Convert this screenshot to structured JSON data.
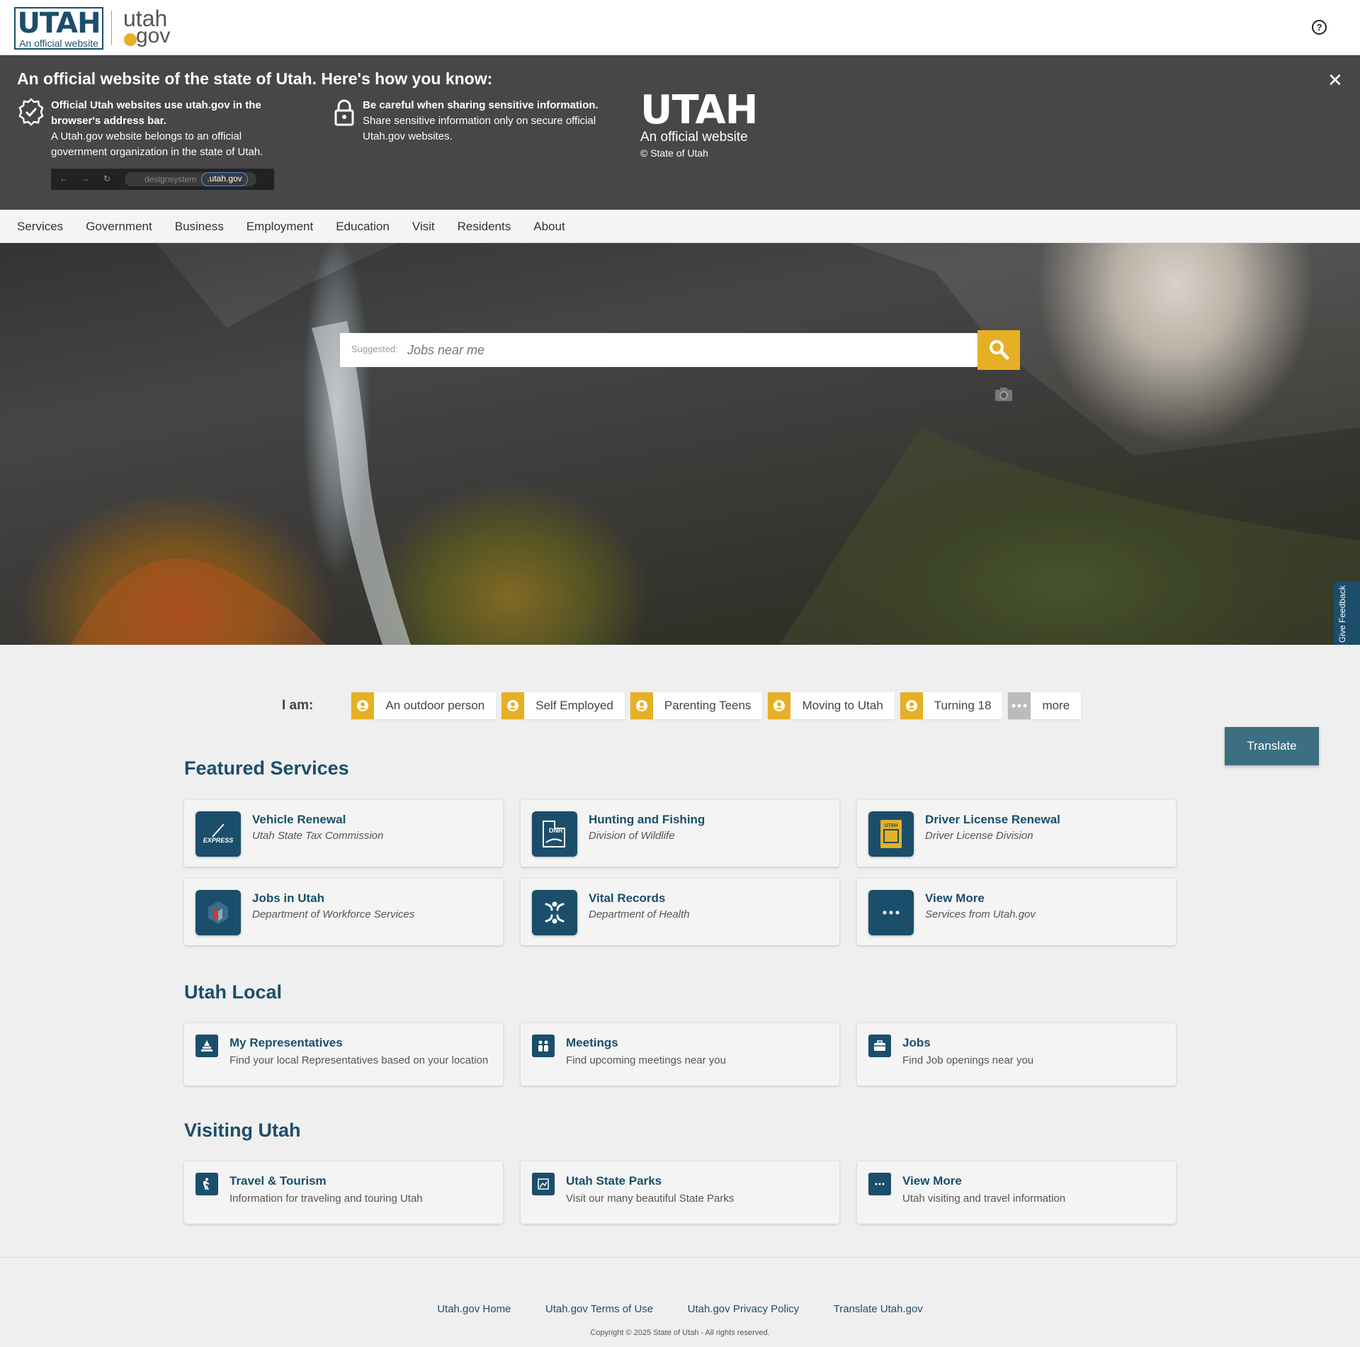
{
  "header": {
    "logo_big": "UTAH",
    "logo_small": "An official website",
    "gov_logo_top": "utah",
    "gov_logo_bottom": "gov",
    "help_symbol": "?"
  },
  "official_banner": {
    "heading": "An official website of the state of Utah. Here's how you know:",
    "close_symbol": "✕",
    "item1_bold": "Official Utah websites use utah.gov in the browser's address bar.",
    "item1_text": "A Utah.gov website belongs to an official government organization in the state of Utah.",
    "item2_bold": "Be careful when sharing sensitive information.",
    "item2_text": "Share sensitive information only on secure official Utah.gov websites.",
    "browser_url_prefix": "designsystem",
    "browser_url_highlight": ".utah.gov",
    "utah_big": "UTAH",
    "utah_sub": "An official website",
    "utah_copy": "© State of Utah"
  },
  "nav": {
    "items": [
      "Services",
      "Government",
      "Business",
      "Employment",
      "Education",
      "Visit",
      "Residents",
      "About"
    ]
  },
  "search": {
    "suggested_label": "Suggested:",
    "placeholder": "Jobs near me"
  },
  "feedback_label": "Give Feedback",
  "iam": {
    "label": "I am:",
    "options": [
      "An outdoor person",
      "Self Employed",
      "Parenting Teens",
      "Moving to Utah",
      "Turning 18",
      "more"
    ]
  },
  "translate_label": "Translate",
  "featured": {
    "title": "Featured Services",
    "cards": [
      {
        "title": "Vehicle Renewal",
        "subtitle": "Utah State Tax Commission",
        "icon": "renewal-express-icon"
      },
      {
        "title": "Hunting and Fishing",
        "subtitle": "Division of Wildlife",
        "icon": "dnr-icon"
      },
      {
        "title": "Driver License Renewal",
        "subtitle": "Driver License Division",
        "icon": "driver-license-icon"
      },
      {
        "title": "Jobs in Utah",
        "subtitle": "Department of Workforce Services",
        "icon": "workforce-icon"
      },
      {
        "title": "Vital Records",
        "subtitle": "Department of Health",
        "icon": "vital-records-icon"
      },
      {
        "title": "View More",
        "subtitle": "Services from Utah.gov",
        "icon": "more-icon"
      }
    ]
  },
  "local": {
    "title": "Utah Local",
    "cards": [
      {
        "title": "My Representatives",
        "subtitle": "Find your local Representatives based on your location",
        "icon": "capitol-icon"
      },
      {
        "title": "Meetings",
        "subtitle": "Find upcoming meetings near you",
        "icon": "meeting-icon"
      },
      {
        "title": "Jobs",
        "subtitle": "Find Job openings near you",
        "icon": "briefcase-icon"
      }
    ]
  },
  "visiting": {
    "title": "Visiting Utah",
    "cards": [
      {
        "title": "Travel & Tourism",
        "subtitle": "Information for traveling and touring Utah",
        "icon": "hiker-icon"
      },
      {
        "title": "Utah State Parks",
        "subtitle": "Visit our many beautiful State Parks",
        "icon": "park-icon"
      },
      {
        "title": "View More",
        "subtitle": "Utah visiting and travel information",
        "icon": "more-icon"
      }
    ]
  },
  "footer": {
    "links": [
      "Utah.gov Home",
      "Utah.gov Terms of Use",
      "Utah.gov Privacy Policy",
      "Translate Utah.gov"
    ],
    "copyright": "Copyright © 2025 State of Utah - All rights reserved."
  },
  "colors": {
    "brand_blue": "#1b4e6b",
    "accent_gold": "#e6b025",
    "banner_grey": "#474747",
    "translate_teal": "#3c6f82"
  }
}
